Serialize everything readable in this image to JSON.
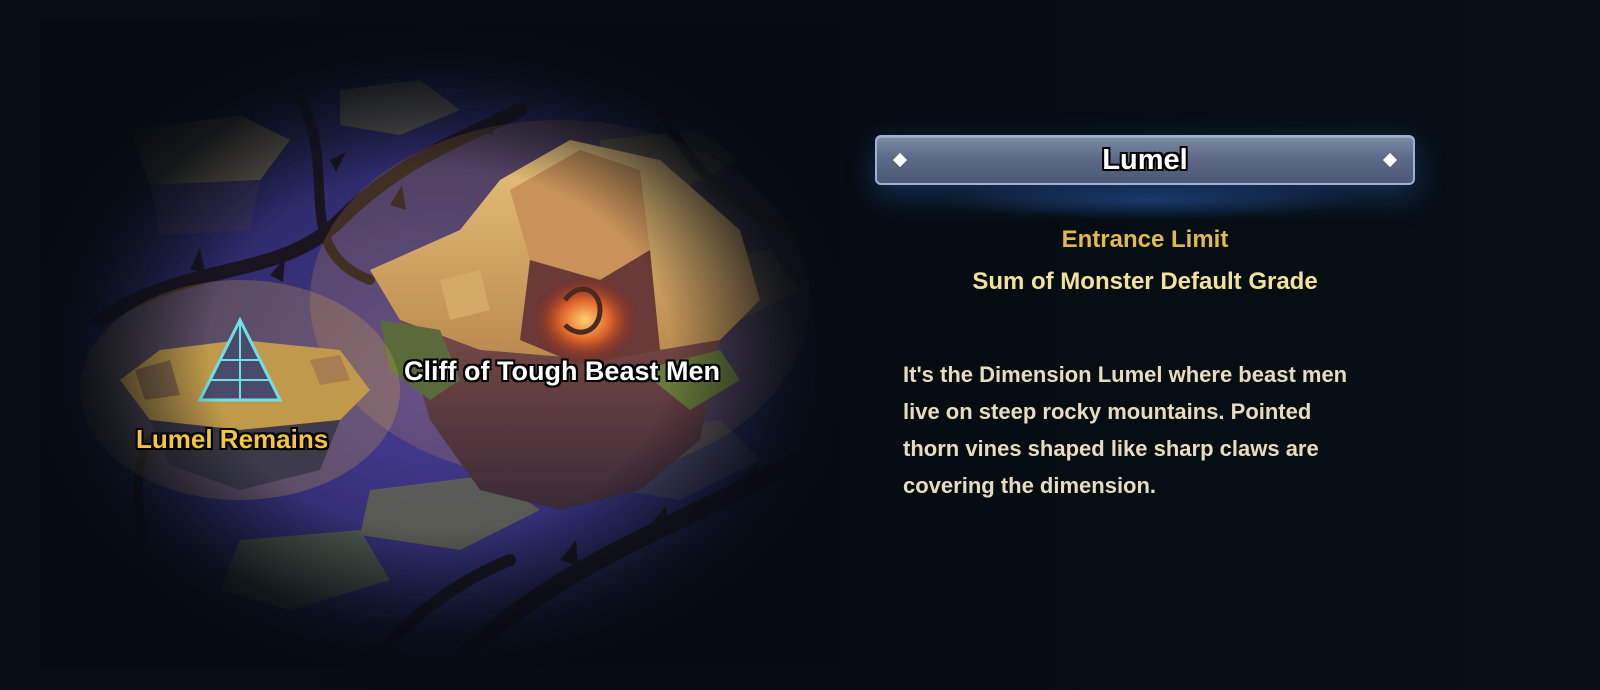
{
  "dimension": {
    "title": "Lumel",
    "entrance_limit_label": "Entrance Limit",
    "entrance_limit_value": "Sum of Monster Default Grade",
    "description": "It's the Dimension Lumel where beast men live on steep rocky mountains. Pointed thorn vines shaped like sharp claws are covering the dimension."
  },
  "map": {
    "locations": [
      {
        "name": "Cliff of Tough Beast Men"
      },
      {
        "name": "Lumel Remains"
      }
    ],
    "icons": [
      "cliff-icon",
      "pyramid-icon",
      "thorn-vine-icon"
    ]
  },
  "colors": {
    "title_bar": "#5d6b88",
    "entrance_label": "#e2b84f",
    "entrance_value": "#f3e39a",
    "location_highlight": "#f5c63d",
    "map_background": "#3a3580"
  }
}
